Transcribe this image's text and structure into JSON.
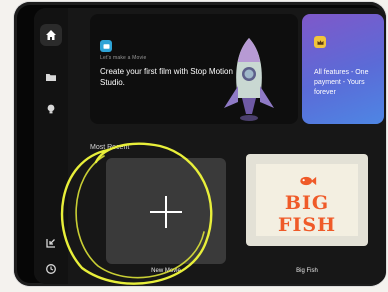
{
  "sidebar": {
    "items": [
      {
        "icon": "home-icon",
        "active": true
      },
      {
        "icon": "folder-icon",
        "active": false
      },
      {
        "icon": "lightbulb-icon",
        "active": false
      }
    ],
    "bottom_items": [
      {
        "icon": "import-icon"
      },
      {
        "icon": "history-icon"
      }
    ]
  },
  "featured": {
    "caption": "Let's make a Movie",
    "title": "Create your first film with Stop Motion Studio."
  },
  "promo": {
    "text": "All features - One payment - Yours forever"
  },
  "recents": {
    "section_label": "Most Recent",
    "new_movie_label": "New Movie",
    "projects": [
      {
        "label": "Big Fish",
        "poster_title": "BIG FISH"
      }
    ]
  },
  "colors": {
    "highlighter": "#e8ef3a",
    "poster_title": "#ef5a28",
    "promo_gradient_start": "#7f58c9",
    "promo_gradient_end": "#4e86e4"
  }
}
